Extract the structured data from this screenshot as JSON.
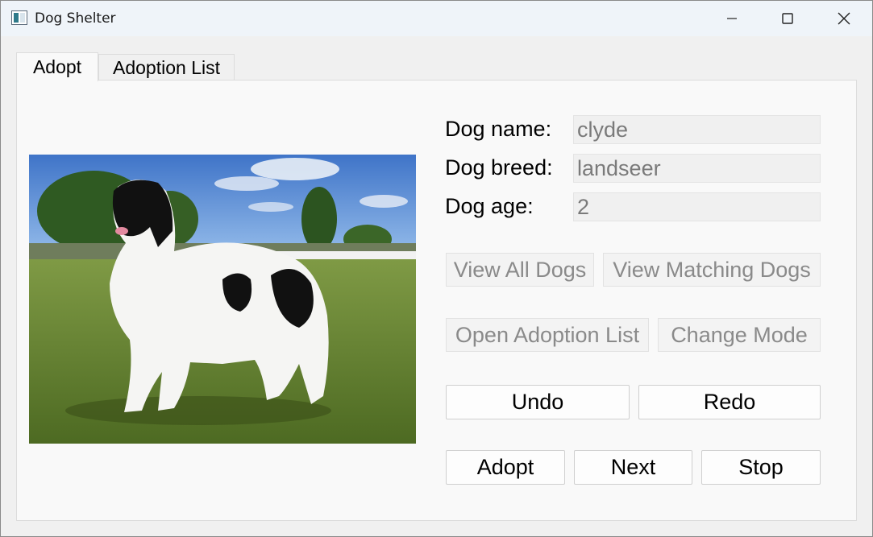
{
  "window": {
    "title": "Dog Shelter",
    "controls": [
      "minimize-icon",
      "maximize-icon",
      "close-icon"
    ]
  },
  "tabs": [
    {
      "label": "Adopt",
      "active": true
    },
    {
      "label": "Adoption List",
      "active": false
    }
  ],
  "dog": {
    "name_label": "Dog name:",
    "name_value": "clyde",
    "breed_label": "Dog breed:",
    "breed_value": "landseer",
    "age_label": "Dog age:",
    "age_value": "2"
  },
  "buttons": {
    "view_all": "View All Dogs",
    "view_matching": "View Matching Dogs",
    "open_adoption_list": "Open Adoption List",
    "change_mode": "Change Mode",
    "undo": "Undo",
    "redo": "Redo",
    "adopt": "Adopt",
    "next": "Next",
    "stop": "Stop"
  },
  "colors": {
    "titlebar": "#eff4f9",
    "pane": "#f9f9f9",
    "disabled_text": "#8a8a8a"
  }
}
